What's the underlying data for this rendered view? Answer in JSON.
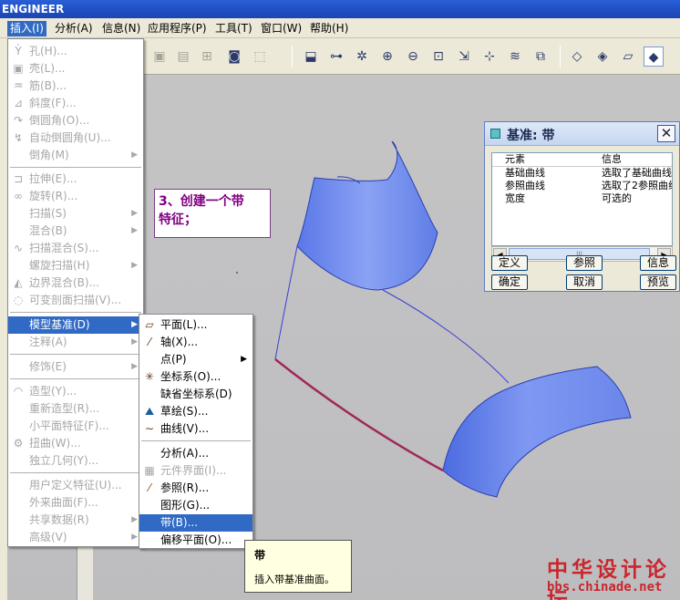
{
  "app": {
    "title": "ENGINEER"
  },
  "menubar": {
    "items": [
      "插入(I)",
      "分析(A)",
      "信息(N)",
      "应用程序(P)",
      "工具(T)",
      "窗口(W)",
      "帮助(H)"
    ]
  },
  "insert_menu": {
    "items": [
      {
        "label": "孔(H)...",
        "icon": "hole-icon",
        "enabled": false
      },
      {
        "label": "壳(L)...",
        "icon": "shell-icon",
        "enabled": false
      },
      {
        "label": "筋(B)...",
        "icon": "rib-icon",
        "enabled": false
      },
      {
        "label": "斜度(F)...",
        "icon": "draft-icon",
        "enabled": false
      },
      {
        "label": "倒圆角(O)...",
        "icon": "round-icon",
        "enabled": false
      },
      {
        "label": "自动倒圆角(U)...",
        "icon": "auto-round-icon",
        "enabled": false
      },
      {
        "label": "倒角(M)",
        "icon": "",
        "enabled": false,
        "submenu": true
      },
      {
        "label": "拉伸(E)...",
        "icon": "extrude-icon",
        "enabled": false
      },
      {
        "label": "旋转(R)...",
        "icon": "revolve-icon",
        "enabled": false
      },
      {
        "label": "扫描(S)",
        "icon": "",
        "enabled": false,
        "submenu": true
      },
      {
        "label": "混合(B)",
        "icon": "",
        "enabled": false,
        "submenu": true
      },
      {
        "label": "扫描混合(S)...",
        "icon": "swept-blend-icon",
        "enabled": false
      },
      {
        "label": "螺旋扫描(H)",
        "icon": "",
        "enabled": false,
        "submenu": true
      },
      {
        "label": "边界混合(B)...",
        "icon": "boundary-blend-icon",
        "enabled": false
      },
      {
        "label": "可变剖面扫描(V)...",
        "icon": "variable-sweep-icon",
        "enabled": false
      },
      {
        "label": "模型基准(D)",
        "icon": "",
        "enabled": true,
        "submenu": true,
        "selected": true
      },
      {
        "label": "注释(A)",
        "icon": "",
        "enabled": false,
        "submenu": true
      },
      {
        "label": "修饰(E)",
        "icon": "",
        "enabled": false,
        "submenu": true
      },
      {
        "label": "造型(Y)...",
        "icon": "style-icon",
        "enabled": false
      },
      {
        "label": "重新造型(R)...",
        "icon": "",
        "enabled": false
      },
      {
        "label": "小平面特征(F)...",
        "icon": "",
        "enabled": false
      },
      {
        "label": "扭曲(W)...",
        "icon": "warp-icon",
        "enabled": false
      },
      {
        "label": "独立几何(Y)...",
        "icon": "",
        "enabled": false
      },
      {
        "label": "用户定义特征(U)...",
        "icon": "",
        "enabled": false
      },
      {
        "label": "外来曲面(F)...",
        "icon": "",
        "enabled": false
      },
      {
        "label": "共享数据(R)",
        "icon": "",
        "enabled": false,
        "submenu": true
      },
      {
        "label": "高级(V)",
        "icon": "",
        "enabled": false,
        "submenu": true
      }
    ]
  },
  "datum_submenu": {
    "items": [
      {
        "label": "平面(L)...",
        "icon": "plane-icon",
        "enabled": true
      },
      {
        "label": "轴(X)...",
        "icon": "axis-icon",
        "enabled": true
      },
      {
        "label": "点(P)",
        "icon": "",
        "enabled": true,
        "submenu": true
      },
      {
        "label": "坐标系(O)...",
        "icon": "csys-icon",
        "enabled": true
      },
      {
        "label": "缺省坐标系(D)",
        "icon": "",
        "enabled": true
      },
      {
        "label": "草绘(S)...",
        "icon": "sketch-icon",
        "enabled": true
      },
      {
        "label": "曲线(V)...",
        "icon": "curve-icon",
        "enabled": true
      },
      {
        "label": "分析(A)...",
        "icon": "",
        "enabled": true
      },
      {
        "label": "元件界面(I)...",
        "icon": "component-interface-icon",
        "enabled": false
      },
      {
        "label": "参照(R)...",
        "icon": "reference-icon",
        "enabled": true
      },
      {
        "label": "图形(G)...",
        "icon": "",
        "enabled": true
      },
      {
        "label": "带(B)...",
        "icon": "",
        "enabled": true,
        "selected": true
      },
      {
        "label": "偏移平面(O)...",
        "icon": "",
        "enabled": true
      }
    ]
  },
  "note": {
    "line1": "3、创建一个带",
    "line2": "特征；"
  },
  "dialog": {
    "title": "基准: 带",
    "columns": [
      "元素",
      "信息"
    ],
    "rows": [
      [
        "基础曲线",
        "选取了基础曲线"
      ],
      [
        "参照曲线",
        "选取了2参照曲线"
      ],
      [
        "宽度",
        "可选的"
      ]
    ],
    "buttons": {
      "define": "定义",
      "refs": "参照",
      "info": "信息",
      "ok": "确定",
      "cancel": "取消",
      "preview": "预览"
    }
  },
  "tooltip": {
    "title": "带",
    "text": "插入带基准曲面。"
  },
  "watermark": {
    "line1": "中华设计论坛",
    "line2": "bbs.chinade.net"
  },
  "colors": {
    "accent": "#316ac5",
    "surface": "#6f8df0",
    "note": "#800080"
  }
}
